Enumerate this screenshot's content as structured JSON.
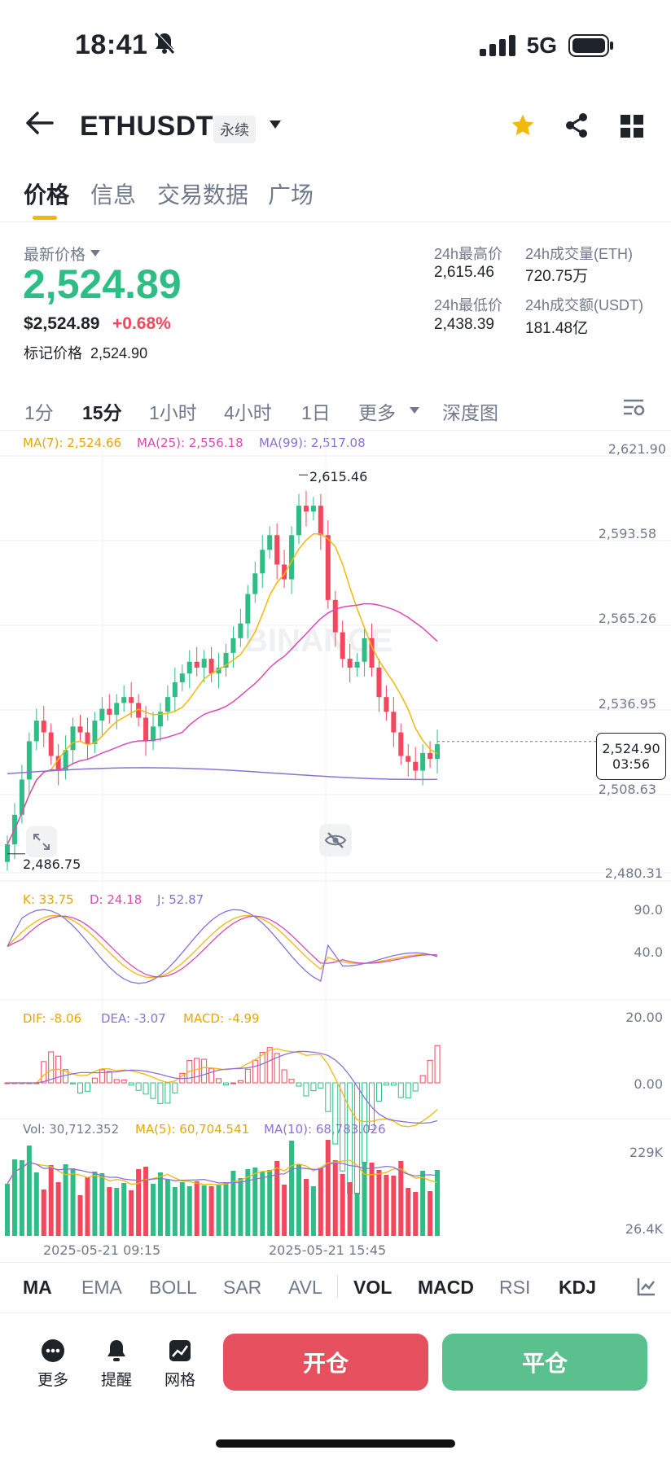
{
  "status": {
    "time": "18:41",
    "network": "5G"
  },
  "header": {
    "symbol": "ETHUSDT",
    "tag": "永续"
  },
  "tabs": [
    {
      "label": "价格"
    },
    {
      "label": "信息"
    },
    {
      "label": "交易数据"
    },
    {
      "label": "广场"
    }
  ],
  "price": {
    "last_label": "最新价格",
    "last": "2,524.89",
    "usd": "$2,524.89",
    "change": "+0.68%",
    "mark_label": "标记价格",
    "mark": "2,524.90"
  },
  "stats": {
    "high_label": "24h最高价",
    "high": "2,615.46",
    "vol_eth_label": "24h成交量(ETH)",
    "vol_eth": "720.75万",
    "low_label": "24h最低价",
    "low": "2,438.39",
    "vol_usdt_label": "24h成交额(USDT)",
    "vol_usdt": "181.48亿"
  },
  "intervals": [
    "1分",
    "15分",
    "1小时",
    "4小时",
    "1日",
    "更多",
    "深度图"
  ],
  "ma_legend": {
    "ma7": "MA(7): 2,524.66",
    "ma25": "MA(25): 2,556.18",
    "ma99": "MA(99): 2,517.08"
  },
  "price_axis": [
    "2,621.90",
    "2,593.58",
    "2,565.26",
    "2,536.95",
    "2,508.63",
    "2,480.31"
  ],
  "chart_marks": {
    "high": "2,615.46",
    "low": "2,486.75",
    "current": "2,524.90",
    "countdown": "03:56"
  },
  "kdj": {
    "k": "K: 33.75",
    "d": "D: 24.18",
    "j": "J: 52.87",
    "axis": [
      "90.0",
      "40.0"
    ]
  },
  "macd": {
    "dif": "DIF: -8.06",
    "dea": "DEA: -3.07",
    "macd": "MACD: -4.99",
    "axis": [
      "20.00",
      "0.00"
    ]
  },
  "vol": {
    "vol": "Vol: 30,712.352",
    "ma5": "MA(5): 60,704.541",
    "ma10": "MA(10): 68,783.026",
    "axis": [
      "229K",
      "26.4K"
    ]
  },
  "time_axis": [
    "2025-05-21 09:15",
    "2025-05-21 15:45"
  ],
  "indicator_tabs": [
    "MA",
    "EMA",
    "BOLL",
    "SAR",
    "AVL",
    "VOL",
    "MACD",
    "RSI",
    "KDJ"
  ],
  "footer": {
    "more": "更多",
    "alert": "提醒",
    "grid": "网格",
    "open": "开仓",
    "close": "平仓"
  },
  "colors": {
    "up": "#2ebd85",
    "down": "#f6465d",
    "brand": "#f0b90b",
    "ma7": "#f0b90b",
    "ma25": "#d94bb4",
    "ma99": "#8a72d4"
  },
  "chart_data": {
    "type": "candlestick",
    "title": "",
    "ylim": [
      2480.31,
      2621.9
    ],
    "close_series": [
      2490,
      2500,
      2512,
      2525,
      2532,
      2528,
      2520,
      2515,
      2522,
      2530,
      2528,
      2524,
      2532,
      2536,
      2534,
      2538,
      2540,
      2538,
      2533,
      2525,
      2530,
      2535,
      2540,
      2545,
      2548,
      2552,
      2550,
      2553,
      2548,
      2550,
      2555,
      2560,
      2565,
      2575,
      2582,
      2590,
      2595,
      2585,
      2580,
      2595,
      2605,
      2603,
      2605,
      2595,
      2573,
      2562,
      2553,
      2550,
      2552,
      2560,
      2550,
      2540,
      2535,
      2528,
      2520,
      2518,
      2515,
      2521,
      2519,
      2524
    ],
    "ma_series": [
      {
        "name": "MA(7)",
        "color": "#f0b90b"
      },
      {
        "name": "MA(25)",
        "color": "#d94bb4"
      },
      {
        "name": "MA(99)",
        "color": "#8a72d4"
      }
    ]
  }
}
